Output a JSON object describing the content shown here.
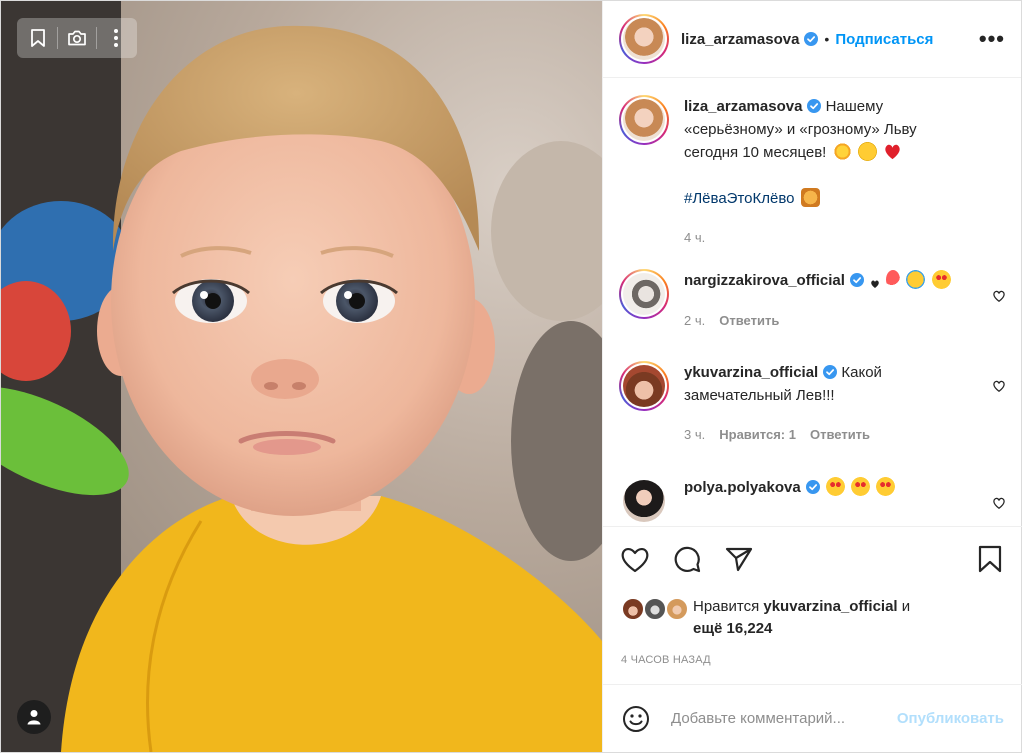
{
  "post": {
    "author": "liza_arzamasova",
    "follow_label": "Подписаться",
    "more_label": "•••",
    "separator": "•",
    "caption_lines": [
      "Нашему",
      "«серьёзному» и «грозному» Льву",
      "сегодня 10 месяцев!"
    ],
    "hashtag": "#ЛёваЭтоКлёво",
    "caption_time": "4 ч.",
    "posted_ago": "4 часов назад"
  },
  "comments": [
    {
      "author": "nargizzakirova_official",
      "text": "",
      "time": "2 ч.",
      "reply": "Ответить",
      "likes": ""
    },
    {
      "author": "ykuvarzina_official",
      "text": "Какой замечательный Лев!!!",
      "time": "3 ч.",
      "reply": "Ответить",
      "likes": "Нравится: 1"
    },
    {
      "author": "polya.polyakova",
      "text": "",
      "time": "",
      "reply": "",
      "likes": ""
    }
  ],
  "likes": {
    "prefix": "Нравится",
    "user": "ykuvarzina_official",
    "conj": "и",
    "rest": "ещё 16,224"
  },
  "composer": {
    "placeholder": "Добавьте комментарий...",
    "publish_label": "Опубликовать"
  },
  "colors": {
    "accent": "#0095f6",
    "publish_disabled": "#b2dffc",
    "verified": "#3897f0",
    "hashtag": "#00376b",
    "muted": "#8e8e8e"
  },
  "icons": [
    "bookmark-icon",
    "camera-icon",
    "vertical-dots-icon",
    "user-tag-icon",
    "heart-icon",
    "comment-icon",
    "share-icon",
    "save-icon",
    "smile-icon",
    "verified-icon",
    "small-heart-icon"
  ]
}
